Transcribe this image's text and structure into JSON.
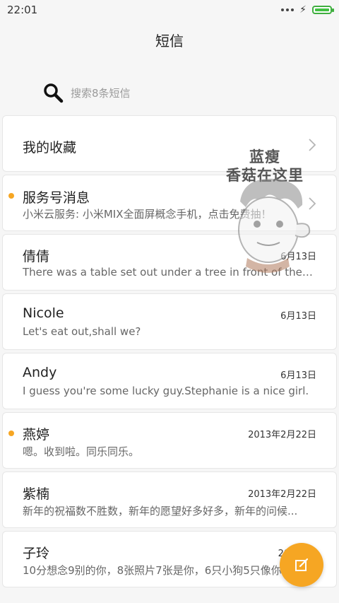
{
  "status_bar": {
    "time": "22:01",
    "icons": [
      "more-dots-icon",
      "charging-bolt-icon",
      "battery-icon"
    ]
  },
  "header": {
    "title": "短信"
  },
  "search": {
    "placeholder": "搜索8条短信",
    "icon": "search-icon"
  },
  "list": {
    "favorites": {
      "label": "我的收藏"
    },
    "service": {
      "title": "服务号消息",
      "preview": "小米云服务: 小米MIX全面屏概念手机，点击免费抽！",
      "unread": true
    },
    "messages": [
      {
        "name": "倩倩",
        "preview": "There was a table set out under a tree in front of the ho...",
        "date": "6月13日",
        "unread": false
      },
      {
        "name": "Nicole",
        "preview": "Let's eat out,shall we?",
        "date": "6月13日",
        "unread": false
      },
      {
        "name": "Andy",
        "preview": "I guess you're some lucky guy.Stephanie is a nice girl.",
        "date": "6月13日",
        "unread": false
      },
      {
        "name": "燕婷",
        "preview": "嗯。收到啦。同乐同乐。",
        "date": "2013年2月22日",
        "unread": true
      },
      {
        "name": "紫楠",
        "preview": "新年的祝福数不胜数，新年的愿望好多好多，新年的问候...",
        "date": "2013年2月22日",
        "unread": false
      },
      {
        "name": "子玲",
        "preview": "10分想念9别的你，8张照片7张是你，6只小狗5只像你",
        "date": "2013年2",
        "unread": false
      }
    ]
  },
  "watermark": {
    "line1": "蓝瘦",
    "line2": "香菇在这里"
  },
  "compose_button": {
    "icon": "compose-icon"
  },
  "colors": {
    "accent": "#f6a623",
    "battery": "#42c142"
  }
}
